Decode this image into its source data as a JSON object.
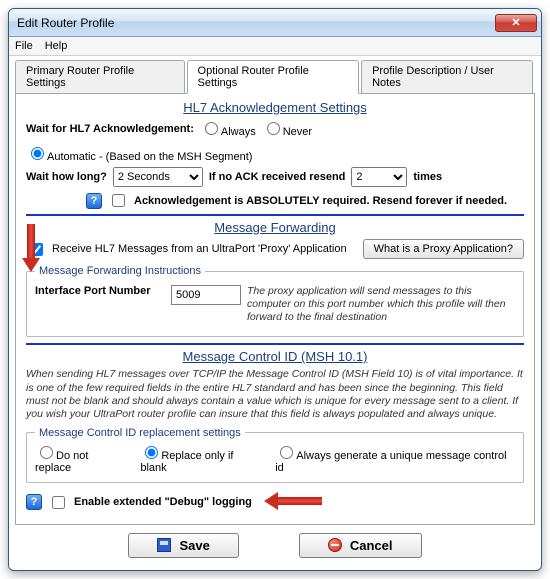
{
  "window": {
    "title": "Edit Router Profile"
  },
  "menu": {
    "file": "File",
    "help": "Help"
  },
  "tabs": {
    "primary": "Primary Router Profile Settings",
    "optional": "Optional Router Profile Settings",
    "desc": "Profile Description / User Notes"
  },
  "ack": {
    "heading": "HL7 Acknowledgement Settings",
    "wait_label": "Wait for HL7 Acknowledgement:",
    "opt_always": "Always",
    "opt_never": "Never",
    "opt_auto": "Automatic - (Based on the MSH Segment)",
    "how_long_label": "Wait how long?",
    "how_long_value": "2 Seconds",
    "noack_label": "If no ACK received resend",
    "resend_value": "2",
    "times": "times",
    "absolute": "Acknowledgement is ABSOLUTELY required. Resend forever if needed."
  },
  "fwd": {
    "heading": "Message Forwarding",
    "receive": "Receive HL7 Messages from an UltraPort 'Proxy' Application",
    "btn": "What is a Proxy Application?",
    "legend": "Message Forwarding Instructions",
    "port_label": "Interface Port Number",
    "port_value": "5009",
    "hint": "The proxy application will send messages to this computer on this port number which this profile will then forward to the final destination"
  },
  "msh": {
    "heading": "Message Control ID (MSH 10.1)",
    "para": "When sending HL7 messages over TCP/IP the Message Control ID (MSH Field 10) is of vital importance. It is one of the few required fields in the entire HL7 standard and has been since the beginning. This field must not be blank and should always contain a value which is unique for every message sent to a client. If you wish your UltraPort router profile can insure that this field is always populated and always unique.",
    "legend": "Message Control ID replacement settings",
    "opt1": "Do not replace",
    "opt2": "Replace only if blank",
    "opt3": "Always generate a unique message control id"
  },
  "debug": {
    "label": "Enable extended \"Debug\" logging"
  },
  "buttons": {
    "save": "Save",
    "cancel": "Cancel"
  }
}
